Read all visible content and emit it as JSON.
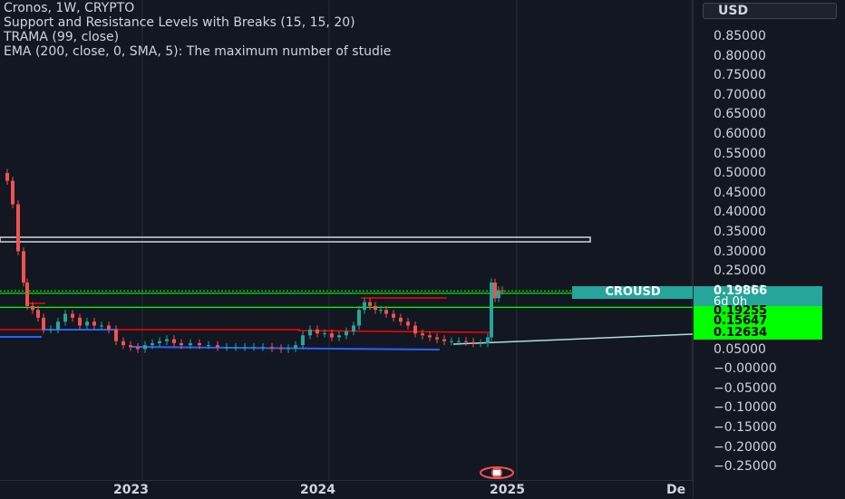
{
  "legend": {
    "line1": "Cronos, 1W, CRYPTO",
    "line2": " Support and Resistance Levels with Breaks (15, 15, 20)",
    "line3": "TRAMA (99, close)",
    "line4": "EMA (200, close, 0, SMA, 5): The maximum number of studie"
  },
  "currency_button": "USD",
  "price_axis": {
    "ticks": [
      "0.85000",
      "0.80000",
      "0.75000",
      "0.70000",
      "0.65000",
      "0.60000",
      "0.55000",
      "0.50000",
      "0.45000",
      "0.40000",
      "0.35000",
      "0.30000",
      "0.25000",
      "0.20000",
      "0.15000",
      "0.10000",
      "0.05000",
      "−0.00000",
      "−0.05000",
      "−0.10000",
      "−0.15000",
      "−0.20000",
      "−0.25000"
    ]
  },
  "price_labels": {
    "last_price": "0.19866",
    "countdown": "6d 0h",
    "level_1": "0.19255",
    "level_2": "0.15647",
    "level_3": "0.12634",
    "symbol_tag": "CROUSD"
  },
  "time_axis": {
    "labels": [
      "2023",
      "2024",
      "2025",
      "De"
    ]
  },
  "colors": {
    "background": "#131722",
    "up": "#26a69a",
    "down": "#ef5350",
    "level_green": "#00ff00",
    "resistance_red": "#ff0000",
    "support_blue": "#2962ff"
  },
  "chart_data": {
    "type": "candlestick",
    "title": "Cronos, 1W, CRYPTO",
    "ylim": [
      -0.27,
      0.88
    ],
    "x": [
      "2022-09",
      "2022-10",
      "2022-11",
      "2022-12",
      "2023-01",
      "2023-02",
      "2023-03",
      "2023-04",
      "2023-05",
      "2023-06",
      "2023-07",
      "2023-08",
      "2023-09",
      "2023-10",
      "2023-11",
      "2023-12",
      "2024-01",
      "2024-02",
      "2024-03",
      "2024-04",
      "2024-05",
      "2024-06",
      "2024-07",
      "2024-08",
      "2024-09",
      "2024-10",
      "2024-11",
      "2024-12"
    ],
    "close": [
      0.5,
      0.31,
      0.13,
      0.09,
      0.08,
      0.085,
      0.075,
      0.07,
      0.065,
      0.06,
      0.058,
      0.056,
      0.055,
      0.06,
      0.075,
      0.09,
      0.11,
      0.13,
      0.16,
      0.15,
      0.13,
      0.11,
      0.095,
      0.085,
      0.08,
      0.075,
      0.16,
      0.19866
    ],
    "levels": [
      0.19255,
      0.15647,
      0.12634
    ]
  }
}
